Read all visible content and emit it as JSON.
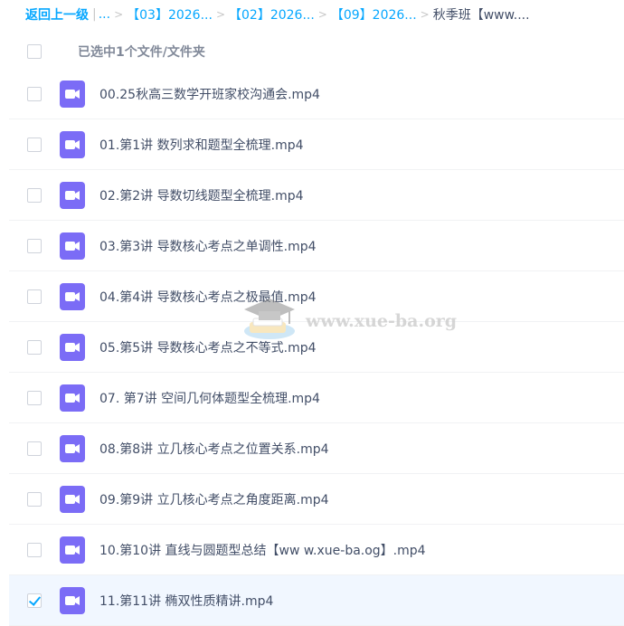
{
  "breadcrumb": {
    "back_label": "返回上一级",
    "pipe": "|",
    "ellipsis": "...",
    "separator": ">",
    "items": [
      {
        "label": "【03】2026..."
      },
      {
        "label": "【02】2026..."
      },
      {
        "label": "【09】2026..."
      }
    ],
    "current": "秋季班【www...."
  },
  "selection": {
    "status_text": "已选中1个文件/文件夹"
  },
  "files": [
    {
      "name": "00.25秋高三数学开班家校沟通会.mp4",
      "checked": false
    },
    {
      "name": "01.第1讲 数列求和题型全梳理.mp4",
      "checked": false
    },
    {
      "name": "02.第2讲 导数切线题型全梳理.mp4",
      "checked": false
    },
    {
      "name": "03.第3讲 导数核心考点之单调性.mp4",
      "checked": false
    },
    {
      "name": "04.第4讲 导数核心考点之极最值.mp4",
      "checked": false
    },
    {
      "name": "05.第5讲 导数核心考点之不等式.mp4",
      "checked": false
    },
    {
      "name": "07. 第7讲 空间几何体题型全梳理.mp4",
      "checked": false
    },
    {
      "name": "08.第8讲 立几核心考点之位置关系.mp4",
      "checked": false
    },
    {
      "name": "09.第9讲 立几核心考点之角度距离.mp4",
      "checked": false
    },
    {
      "name": "10.第10讲 直线与圆题型总结【ww w.xue-ba.og】.mp4",
      "checked": false
    },
    {
      "name": "11.第11讲 椭双性质精讲.mp4",
      "checked": true
    }
  ],
  "watermark": {
    "text": "www.xue-ba.org"
  },
  "colors": {
    "accent": "#06a7ff",
    "video_icon": "#7b6cf6",
    "selected_row": "#f1f7ff",
    "text": "#424e67",
    "muted": "#818999"
  },
  "icons": {
    "file": "video-file-icon",
    "check": "check-icon",
    "watermark_logo": "graduation-cap-logo"
  }
}
